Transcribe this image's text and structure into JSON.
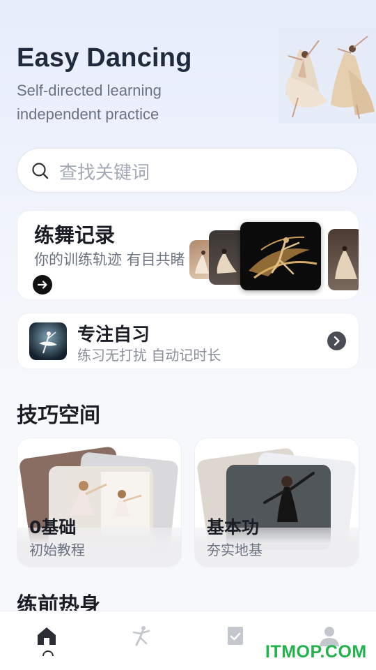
{
  "hero": {
    "title": "Easy Dancing",
    "subtitle_line1": "Self-directed learning",
    "subtitle_line2": "independent practice"
  },
  "search": {
    "placeholder": "查找关键词",
    "icon": "search-icon"
  },
  "record_card": {
    "title": "练舞记录",
    "subtitle": "你的训练轨迹 有目共睹",
    "arrow_icon": "arrow-right-icon"
  },
  "focus_card": {
    "title": "专注自习",
    "subtitle": "练习无打扰 自动记时长",
    "go_icon": "chevron-right-icon"
  },
  "skills": {
    "title": "技巧空间",
    "items": [
      {
        "name": "0基础",
        "desc": "初始教程"
      },
      {
        "name": "基本功",
        "desc": "夯实地基"
      }
    ]
  },
  "warmup": {
    "title": "练前热身"
  },
  "tabbar": {
    "items": [
      {
        "icon": "home-icon",
        "active": true
      },
      {
        "icon": "dancer-icon",
        "active": false
      },
      {
        "icon": "checklist-icon",
        "active": false
      },
      {
        "icon": "profile-icon",
        "active": false
      }
    ]
  },
  "watermark": "ITMOP.COM",
  "colors": {
    "accent_dark": "#1f2a3d",
    "watermark_green": "#23b24b",
    "background": "#eef2fb"
  }
}
